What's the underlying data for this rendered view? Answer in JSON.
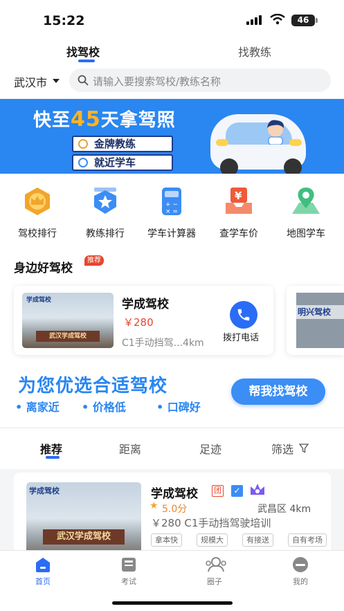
{
  "status": {
    "time": "15:22",
    "battery": "46"
  },
  "top_tabs": {
    "active": "找驾校",
    "inactive": "找教练"
  },
  "search": {
    "city": "武汉市",
    "placeholder": "请输入要搜索驾校/教练名称"
  },
  "banner": {
    "headline_pre": "快至",
    "headline_num": "45",
    "headline_post": "天拿驾照",
    "pill_1": "金牌教练",
    "pill_2": "就近学车"
  },
  "quick_menu": [
    {
      "label": "驾校排行",
      "icon": "crown-badge-icon",
      "color": "#f2a52b"
    },
    {
      "label": "教练排行",
      "icon": "star-shield-icon",
      "color": "#3b8df5"
    },
    {
      "label": "学车计算器",
      "icon": "calculator-icon",
      "color": "#3b8df5"
    },
    {
      "label": "查学车价",
      "icon": "yuan-tray-icon",
      "color": "#ee5a3a"
    },
    {
      "label": "地图学车",
      "icon": "map-pin-icon",
      "color": "#3fbf7f"
    }
  ],
  "nearby": {
    "title": "身边好驾校",
    "badge": "推荐",
    "card": {
      "photo_logo": "学成驾校",
      "photo_sign": "武汉学成驾校",
      "name": "学成驾校",
      "price": "￥280",
      "desc": "C1手动挡驾...4km",
      "call_label": "拨打电话"
    },
    "card2_sign": "明兴驾校"
  },
  "promo": {
    "headline": "为您优选合适驾校",
    "points": [
      "• 离家近",
      "• 价格低",
      "• 口碑好"
    ],
    "button": "帮我找驾校"
  },
  "filters": {
    "tabs": [
      "推荐",
      "距离",
      "足迹",
      "筛选"
    ],
    "active": "推荐"
  },
  "school": {
    "photo_logo": "学成驾校",
    "photo_sign": "武汉学成驾校",
    "name": "学成驾校",
    "badge_tuan": "团",
    "badge_check": "✓",
    "rating": "5.0分",
    "district": "武昌区",
    "distance": "4km",
    "price_desc": "￥280 C1手动挡驾驶培训",
    "tags": [
      "拿本快",
      "规模大",
      "有接送",
      "自有考场"
    ]
  },
  "tabbar": [
    {
      "label": "首页",
      "icon": "home-icon"
    },
    {
      "label": "考试",
      "icon": "exam-icon"
    },
    {
      "label": "圈子",
      "icon": "community-icon"
    },
    {
      "label": "我的",
      "icon": "profile-icon"
    }
  ],
  "colors": {
    "brand": "#2a6cf6",
    "price": "#e8452d",
    "banner": "#2a86f0"
  }
}
